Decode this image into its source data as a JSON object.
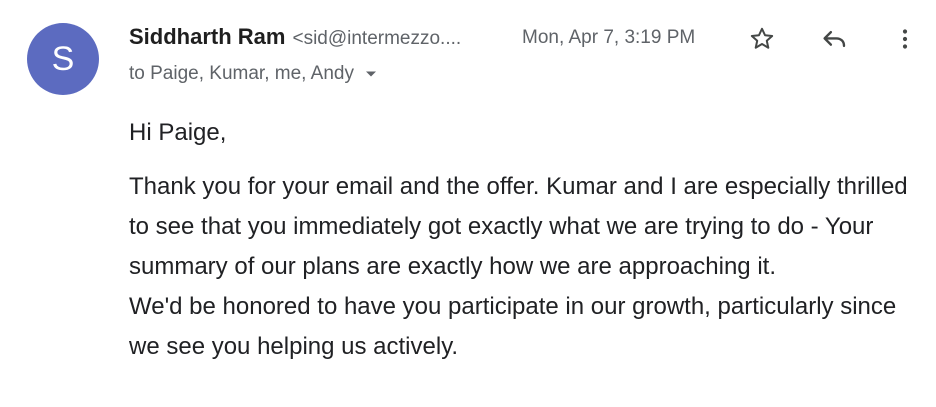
{
  "sender": {
    "initial": "S",
    "avatar_color": "#5c6bc0",
    "name": "Siddharth Ram",
    "email": "<sid@intermezzo...."
  },
  "timestamp": "Mon, Apr 7, 3:19 PM",
  "actions": {
    "star_icon": "star-icon",
    "reply_icon": "reply-icon",
    "more_icon": "more-vertical-icon"
  },
  "recipients": {
    "text": "to Paige, Kumar, me, Andy",
    "caret_icon": "caret-down-icon"
  },
  "body": {
    "greeting": "Hi Paige,",
    "paragraph1": "Thank you for your email and the offer. Kumar and I are especially thrilled to see that you immediately got exactly what we are trying to do - Your summary of our plans are exactly how we are approaching it.",
    "paragraph2": "We'd be honored to have you participate in our growth, particularly since we see you helping us actively."
  }
}
